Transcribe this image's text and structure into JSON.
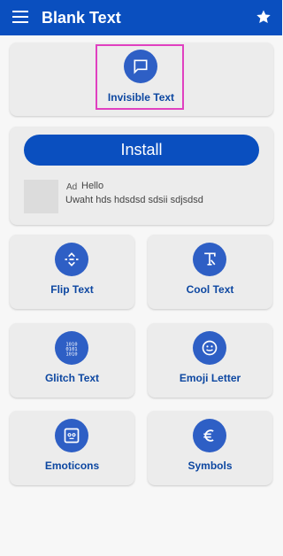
{
  "app_bar": {
    "title": "Blank Text",
    "background": "#0a4fbf",
    "menu_icon": "hamburger-menu-icon",
    "star_icon": "star-icon"
  },
  "feature": {
    "label": "Invisible Text",
    "icon": "chat-bubble-icon",
    "highlight_color": "#e040c0"
  },
  "ad": {
    "install_label": "Install",
    "badge": "Ad",
    "title": "Hello",
    "body": "Uwaht hds hdsdsd sdsii sdjsdsd"
  },
  "tiles": [
    {
      "label": "Flip Text",
      "icon": "flip-vertical-icon"
    },
    {
      "label": "Cool Text",
      "icon": "text-format-icon"
    },
    {
      "label": "Glitch Text",
      "icon": "binary-icon"
    },
    {
      "label": "Emoji Letter",
      "icon": "smiley-icon"
    },
    {
      "label": "Emoticons",
      "icon": "emoticon-face-icon"
    },
    {
      "label": "Symbols",
      "icon": "euro-icon"
    }
  ],
  "colors": {
    "accent": "#2e5fc5",
    "label_blue": "#0d47a1",
    "card": "#ececec"
  }
}
